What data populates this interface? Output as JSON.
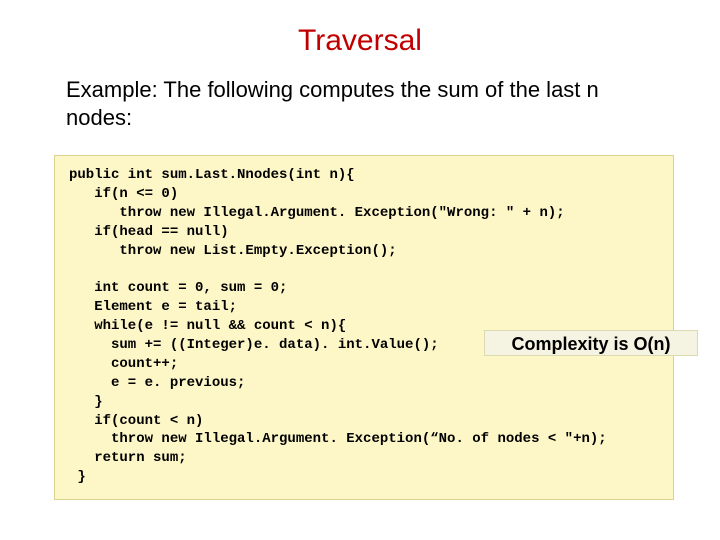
{
  "title": "Traversal",
  "description": "Example: The following computes the sum of the last n nodes:",
  "code": "public int sum.Last.Nnodes(int n){\n   if(n <= 0)\n      throw new Illegal.Argument. Exception(\"Wrong: \" + n);\n   if(head == null)\n      throw new List.Empty.Exception();\n\n   int count = 0, sum = 0;\n   Element e = tail;\n   while(e != null && count < n){\n     sum += ((Integer)e. data). int.Value();\n     count++;\n     e = e. previous;\n   }\n   if(count < n)\n     throw new Illegal.Argument. Exception(“No. of nodes < \"+n);\n   return sum;\n }",
  "complexity_label": "Complexity is O(n)"
}
